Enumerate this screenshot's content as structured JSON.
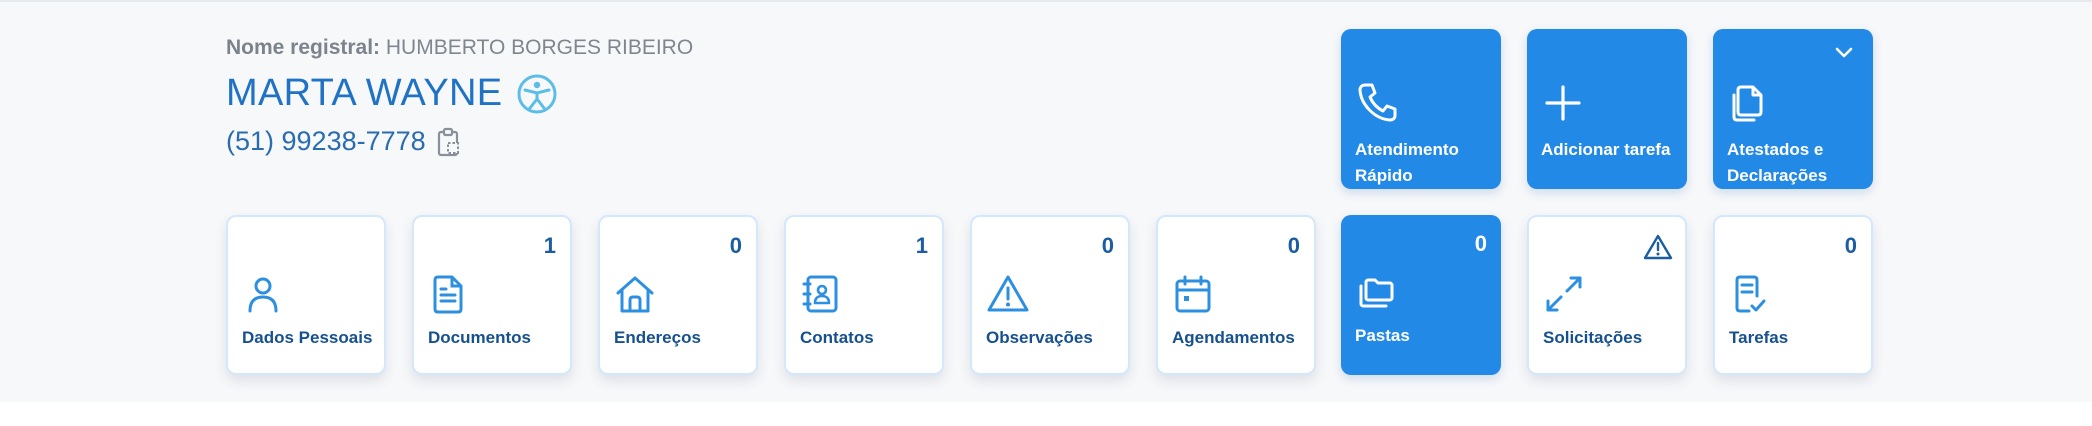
{
  "header": {
    "registered_name_label": "Nome registral:",
    "registered_name_value": "HUMBERTO BORGES RIBEIRO",
    "display_name": "MARTA WAYNE",
    "display_name_icon": "accessibility-icon",
    "phone": "(51) 99238-7778",
    "phone_icon": "clipboard-copy-icon"
  },
  "actions": [
    {
      "label_line1": "Atendimento",
      "label_line2": "Rápido",
      "icon": "phone-icon"
    },
    {
      "label_line1": "Adicionar tarefa",
      "label_line2": "",
      "icon": "plus-icon"
    },
    {
      "label_line1": "Atestados e",
      "label_line2": "Declarações",
      "icon": "documents-copy-icon",
      "dropdown_icon": "chevron-down-icon"
    }
  ],
  "tiles": [
    {
      "label": "Dados Pessoais",
      "count": "",
      "icon": "user-icon"
    },
    {
      "label": "Documentos",
      "count": "1",
      "icon": "document-icon"
    },
    {
      "label": "Endereços",
      "count": "0",
      "icon": "home-icon"
    },
    {
      "label": "Contatos",
      "count": "1",
      "icon": "contact-book-icon"
    },
    {
      "label": "Observações",
      "count": "0",
      "icon": "warning-icon"
    },
    {
      "label": "Agendamentos",
      "count": "0",
      "icon": "calendar-icon"
    },
    {
      "label": "Pastas",
      "count": "0",
      "icon": "folders-icon",
      "active": true
    },
    {
      "label": "Solicitações",
      "count": "",
      "icon": "transfer-arrows-icon",
      "badge_icon": "warning-icon"
    },
    {
      "label": "Tarefas",
      "count": "0",
      "icon": "task-check-icon"
    }
  ],
  "colors": {
    "primary": "#2289E6",
    "text_dark_blue": "#17508F",
    "name_blue": "#1F72C4",
    "tile_border": "#D3E8FA",
    "panel_bg": "#F7F8FA"
  }
}
